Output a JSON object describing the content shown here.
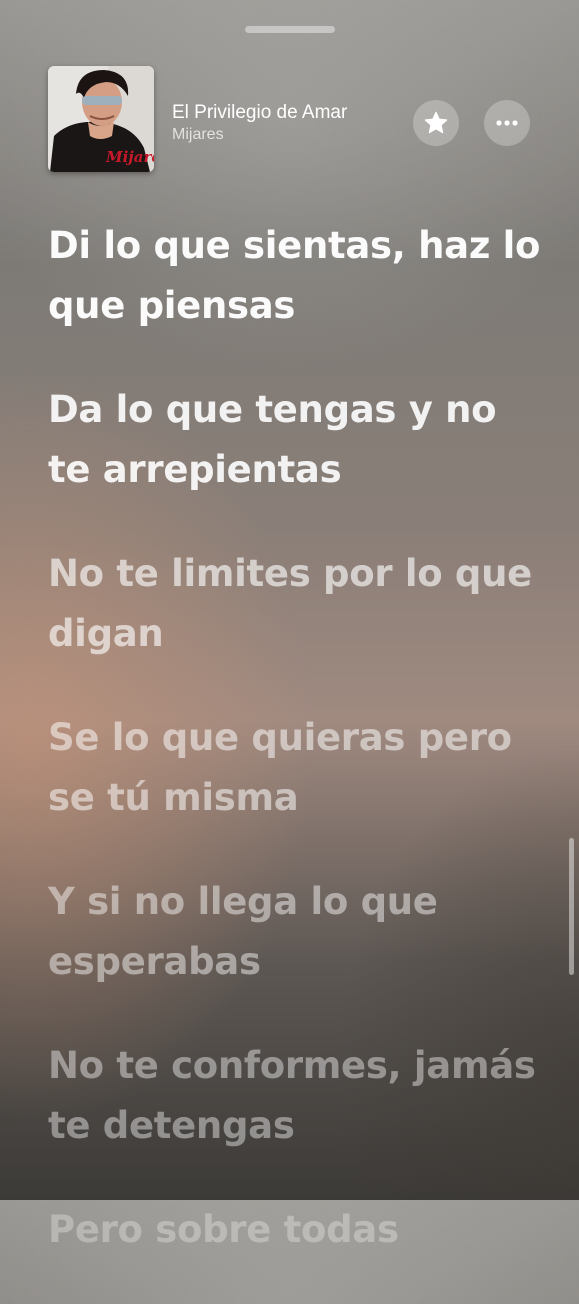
{
  "now_playing": {
    "title": "El Privilegio de Amar",
    "artist": "Mijares",
    "album_art_text": "Mijares"
  },
  "buttons": {
    "favorite_icon": "star-icon",
    "more_icon": "ellipsis-icon"
  },
  "lyrics": [
    "Di lo que sientas, haz lo que piensas",
    "Da lo que tengas y no te arrepientas",
    "No te limites por lo que digan",
    "Se lo que quieras pero se tú misma",
    "Y si no llega lo que esperabas",
    "No te conformes, jamás te detengas",
    "Pero sobre todas"
  ],
  "colors": {
    "text": "#ffffff",
    "button_fill": "rgba(255,255,255,0.26)",
    "album_logo_red": "#c8192a"
  }
}
